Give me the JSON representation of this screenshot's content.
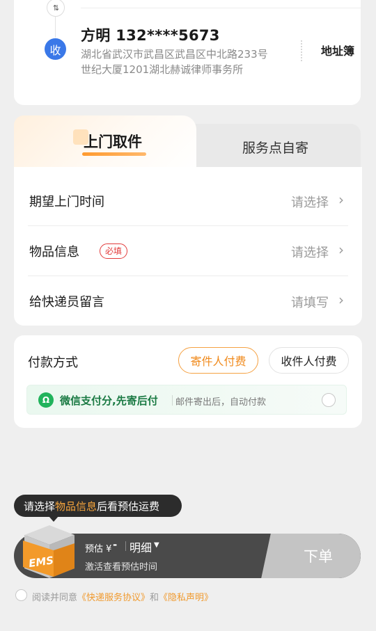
{
  "receiver": {
    "tag": "收",
    "name": "方明 132****5673",
    "address_line1": "湖北省武汉市武昌区武昌区中北路233号",
    "address_line2": "世纪大厦1201湖北赫诚律师事务所",
    "address_book_label": "地址簿",
    "swap_glyph": "⇅"
  },
  "tabs": [
    {
      "label": "上门取件",
      "active": true
    },
    {
      "label": "服务点自寄",
      "active": false
    }
  ],
  "options": [
    {
      "label": "期望上门时间",
      "value": "请选择"
    },
    {
      "label": "物品信息",
      "badge": "必填",
      "value": "请选择"
    },
    {
      "label": "给快递员留言",
      "value": "请填写"
    }
  ],
  "payment": {
    "title": "付款方式",
    "sender_pay": "寄件人付费",
    "receiver_pay": "收件人付费",
    "wechat_title": "微信支付分,先寄后付",
    "wechat_sub": "邮件寄出后，自动付款",
    "wechat_icon_glyph": "Ω"
  },
  "tooltip": {
    "prefix": "请选择",
    "highlight": "物品信息",
    "suffix": "后看预估运费"
  },
  "bottom_bar": {
    "estimate_label": "预估 ¥",
    "estimate_value": "-",
    "detail_label": "明细",
    "activate_text": "激活查看预估时间",
    "order_button": "下单",
    "brand_label": "EMS"
  },
  "agreement": {
    "prefix": "阅读并同意",
    "link1": "《快递服务协议》",
    "and": "和",
    "link2": "《隐私声明》"
  },
  "colors": {
    "accent": "#f08a1c",
    "receiver_blue": "#3a78e8",
    "wechat_green": "#21b35c",
    "required_red": "#e23b3b"
  }
}
